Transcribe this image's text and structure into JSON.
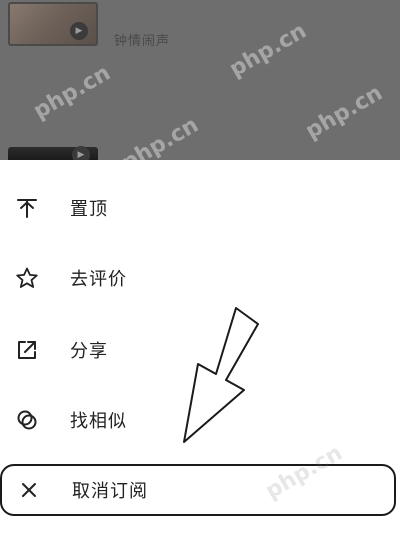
{
  "background": {
    "track_title": "钟情闹声",
    "watermark": "php.cn"
  },
  "menu": {
    "items": [
      {
        "label": "置顶",
        "icon": "pin-top-icon"
      },
      {
        "label": "去评价",
        "icon": "star-icon"
      },
      {
        "label": "分享",
        "icon": "share-icon"
      },
      {
        "label": "找相似",
        "icon": "find-similar-icon"
      },
      {
        "label": "取消订阅",
        "icon": "close-icon"
      }
    ]
  },
  "colors": {
    "overlay": "#6e6e6e",
    "sheet": "#ffffff",
    "text": "#222222",
    "highlight_border": "#1a1a1a"
  }
}
